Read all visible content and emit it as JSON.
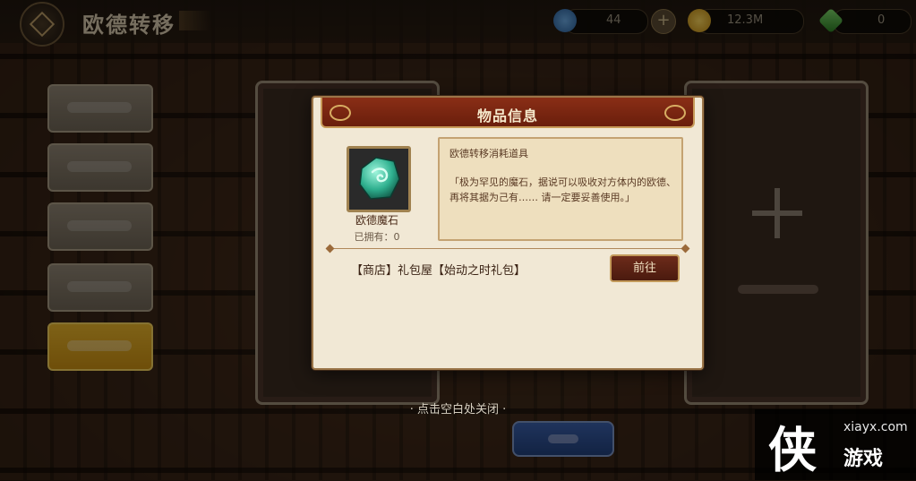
{
  "header": {
    "title": "欧德转移",
    "currencies": [
      {
        "icon": "blue-gem-icon",
        "value": "44",
        "color": "#3f7fb8"
      },
      {
        "icon": "gold-coin-icon",
        "value": "12.3M",
        "color": "#d9a21c"
      },
      {
        "icon": "green-crystal-icon",
        "value": "0",
        "color": "#3c9a3a"
      }
    ],
    "add_icon": "+"
  },
  "dialog": {
    "title": "物品信息",
    "item": {
      "name": "欧德魔石",
      "owned": "已拥有：0",
      "icon": "ode-magic-stone-icon"
    },
    "description": {
      "title": "欧德转移消耗道具",
      "body": "「极为罕见的魔石，据说可以吸收对方体内的欧德、再将其据为己有…… 请一定要妥善使用。」"
    },
    "source": "【商店】礼包屋【始动之时礼包】",
    "go_button": "前往"
  },
  "close_hint": "· 点击空白处关闭 ·",
  "watermark": {
    "logo": "侠",
    "site": "xiayx.com",
    "name": "游戏"
  }
}
